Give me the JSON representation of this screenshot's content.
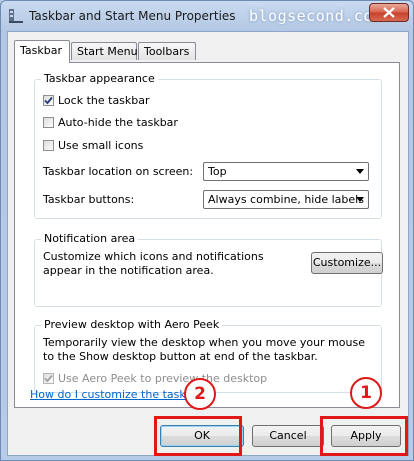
{
  "window": {
    "title": "Taskbar and Start Menu Properties",
    "watermark": "blogsecond.com"
  },
  "tabs": [
    {
      "label": "Taskbar",
      "active": true
    },
    {
      "label": "Start Menu",
      "active": false
    },
    {
      "label": "Toolbars",
      "active": false
    }
  ],
  "appearance": {
    "legend": "Taskbar appearance",
    "lock": {
      "label": "Lock the taskbar",
      "checked": true
    },
    "autohide": {
      "label": "Auto-hide the taskbar",
      "checked": false
    },
    "small_icons": {
      "label": "Use small icons",
      "checked": false
    },
    "location": {
      "label": "Taskbar location on screen:",
      "value": "Top"
    },
    "buttons": {
      "label": "Taskbar buttons:",
      "value": "Always combine, hide labels"
    }
  },
  "notification": {
    "legend": "Notification area",
    "description": "Customize which icons and notifications appear in the notification area.",
    "customize_label": "Customize..."
  },
  "aero_peek": {
    "legend": "Preview desktop with Aero Peek",
    "description": "Temporarily view the desktop when you move your mouse to the Show desktop button at end of the taskbar.",
    "checkbox": {
      "label": "Use Aero Peek to preview the desktop",
      "checked": true,
      "disabled": true
    }
  },
  "help_link": "How do I customize the taskbar?",
  "footer": {
    "ok_label": "OK",
    "cancel_label": "Cancel",
    "apply_label": "Apply"
  },
  "annotations": {
    "badge_ok": "2",
    "badge_apply": "1",
    "highlight_color": "#e01818"
  }
}
